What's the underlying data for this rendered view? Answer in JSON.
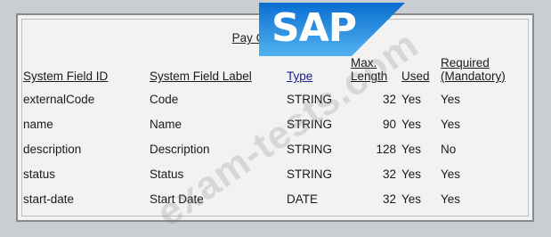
{
  "title": "Pay Component",
  "columns": {
    "system_field_id": "System Field ID",
    "system_field_label": "System Field Label",
    "type": "Type",
    "max_length_line1": "Max.",
    "max_length_line2": "Length",
    "used": "Used",
    "required_line1": "Required",
    "required_line2": "(Mandatory)"
  },
  "rows": [
    {
      "id": "externalCode",
      "label": "Code",
      "type": "STRING",
      "max_length": "32",
      "used": "Yes",
      "required": "Yes"
    },
    {
      "id": "name",
      "label": "Name",
      "type": "STRING",
      "max_length": "90",
      "used": "Yes",
      "required": "Yes"
    },
    {
      "id": "description",
      "label": "Description",
      "type": "STRING",
      "max_length": "128",
      "used": "Yes",
      "required": "No"
    },
    {
      "id": "status",
      "label": "Status",
      "type": "STRING",
      "max_length": "32",
      "used": "Yes",
      "required": "Yes"
    },
    {
      "id": "start-date",
      "label": "Start Date",
      "type": "DATE",
      "max_length": "32",
      "used": "Yes",
      "required": "Yes"
    }
  ],
  "logo": {
    "text": "SAP"
  },
  "watermark": "exam-tests.com",
  "colors": {
    "background": "#c9ced3",
    "panel": "#f2f2f2",
    "logo_blue_top": "#0a6ed1",
    "logo_blue_bottom": "#52b3f0"
  }
}
